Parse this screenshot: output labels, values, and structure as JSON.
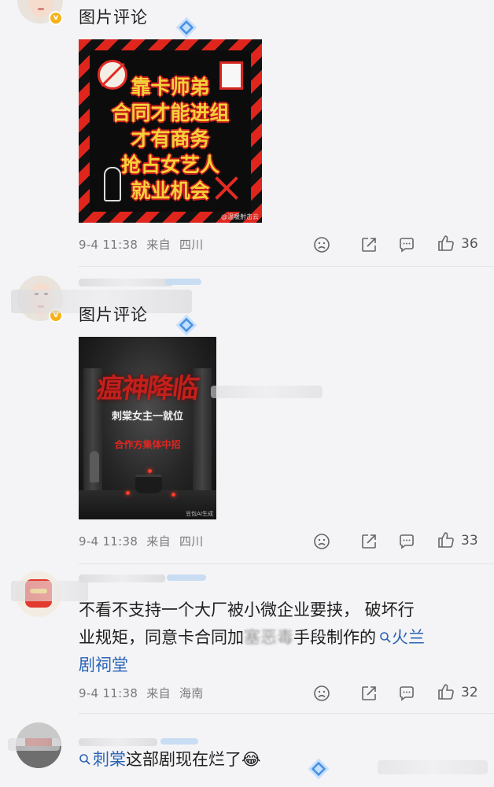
{
  "comments": [
    {
      "label": "图片评论",
      "image_text": [
        "靠卡师弟",
        "合同才能进组",
        "才有商务",
        "抢占女艺人",
        "就业机会"
      ],
      "image_watermark": "@温暖射击云",
      "time": "9-4 11:38",
      "from": "来自",
      "location": "四川",
      "likes": "36"
    },
    {
      "label": "图片评论",
      "image_title": "瘟神降临",
      "image_sub1": "刺棠女主一就位",
      "image_sub2": "合作方集体中招",
      "image_watermark": "豆包AI生成",
      "time": "9-4 11:38",
      "from": "来自",
      "location": "四川",
      "likes": "33"
    },
    {
      "text_part1": "不看不支持一个大厂被小微企业要挟，  破坏行",
      "text_part2": "业规矩，同意卡合同加",
      "text_blurred": "塞恶毒",
      "text_part3": "手段制作的",
      "link_text": "火兰",
      "text_part4": "剧祠堂",
      "time": "9-4 11:38",
      "from": "来自",
      "location": "海南",
      "likes": "32"
    },
    {
      "link_text": "刺棠",
      "text": "这部剧现在烂了",
      "emoji": "😂"
    }
  ],
  "colors": {
    "link": "#2a64b5",
    "badge": "#f6b21a",
    "hazard_red": "#e0251d"
  },
  "icons": [
    "search-icon",
    "sad-face-icon",
    "share-icon",
    "comment-icon",
    "thumb-up-icon",
    "diamond-icon",
    "verified-badge-icon"
  ]
}
